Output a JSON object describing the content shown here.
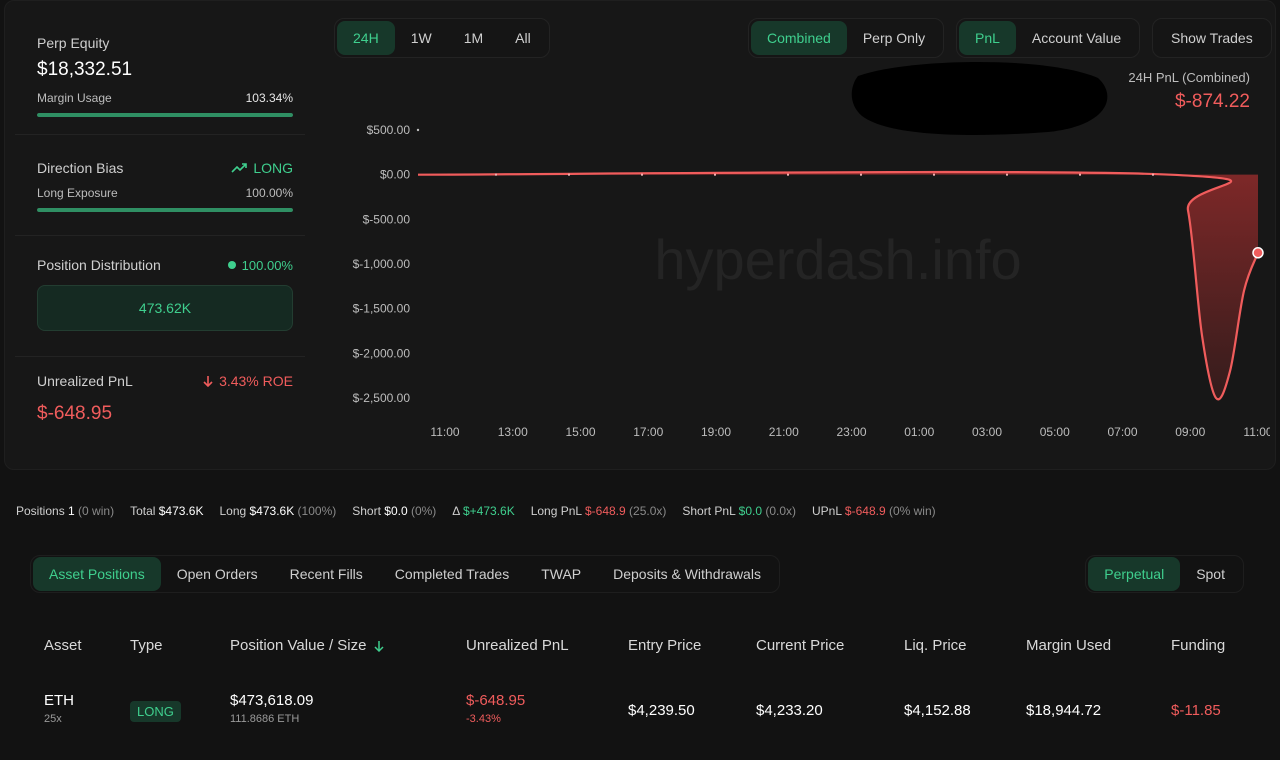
{
  "sidebar": {
    "perp_equity_label": "Perp Equity",
    "perp_equity_value": "$18,332.51",
    "margin_usage_label": "Margin Usage",
    "margin_usage_value": "103.34%",
    "margin_usage_fill": 1.0,
    "direction_bias_label": "Direction Bias",
    "direction_bias_value": "LONG",
    "long_exposure_label": "Long Exposure",
    "long_exposure_value": "100.00%",
    "long_exposure_fill": 1.0,
    "position_distribution_label": "Position Distribution",
    "position_distribution_value": "100.00%",
    "distribution_box_value": "473.62K",
    "unrealized_pnl_label": "Unrealized PnL",
    "unrealized_pnl_roe": "3.43% ROE",
    "unrealized_pnl_value": "$-648.95"
  },
  "timeframes": [
    {
      "label": "24H",
      "active": true
    },
    {
      "label": "1W",
      "active": false
    },
    {
      "label": "1M",
      "active": false
    },
    {
      "label": "All",
      "active": false
    }
  ],
  "modes": [
    {
      "label": "Combined",
      "active": true
    },
    {
      "label": "Perp Only",
      "active": false
    }
  ],
  "metrics": [
    {
      "label": "PnL",
      "active": true
    },
    {
      "label": "Account Value",
      "active": false
    }
  ],
  "show_trades_label": "Show Trades",
  "chart_header": {
    "title": "24H PnL (Combined)",
    "value": "$-874.22"
  },
  "chart_data": {
    "type": "area",
    "title": "24H PnL (Combined)",
    "watermark": "hyperdash.info",
    "x_ticks": [
      "11:00",
      "13:00",
      "15:00",
      "17:00",
      "19:00",
      "21:00",
      "23:00",
      "01:00",
      "03:00",
      "05:00",
      "07:00",
      "09:00",
      "11:00"
    ],
    "y_ticks": [
      "$500.00",
      "$0.00",
      "$-500.00",
      "$-1,000.00",
      "$-1,500.00",
      "$-2,000.00",
      "$-2,500.00"
    ],
    "y_tick_values": [
      500,
      0,
      -500,
      -1000,
      -1500,
      -2000,
      -2500
    ],
    "ylim": [
      -2500,
      500
    ],
    "xlim": [
      0,
      24
    ],
    "series": [
      {
        "x": [
          0,
          21.5,
          22.0,
          22.4,
          22.8,
          23.2,
          23.6,
          24.0
        ],
        "values": [
          0,
          0,
          -400,
          -1800,
          -2500,
          -2200,
          -1300,
          -874.22
        ]
      }
    ],
    "colors": {
      "line": "#f05c5c",
      "fill": "#8a2a2a"
    }
  },
  "stats": [
    {
      "label": "Positions",
      "value": "1",
      "extra": "(0 win)",
      "color": "#ffffff"
    },
    {
      "label": "Total",
      "value": "$473.6K",
      "extra": "",
      "color": "#ffffff"
    },
    {
      "label": "Long",
      "value": "$473.6K",
      "extra": "(100%)",
      "color": "#ffffff"
    },
    {
      "label": "Short",
      "value": "$0.0",
      "extra": "(0%)",
      "color": "#ffffff"
    },
    {
      "label": "Δ",
      "value": "$+473.6K",
      "extra": "",
      "color": "#3fcf8e"
    },
    {
      "label": "Long PnL",
      "value": "$-648.9",
      "extra": "(25.0x)",
      "color": "#f05c5c"
    },
    {
      "label": "Short PnL",
      "value": "$0.0",
      "extra": "(0.0x)",
      "color": "#3fcf8e"
    },
    {
      "label": "UPnL",
      "value": "$-648.9",
      "extra": "(0% win)",
      "color": "#f05c5c"
    }
  ],
  "tabs": [
    {
      "label": "Asset Positions",
      "active": true
    },
    {
      "label": "Open Orders",
      "active": false
    },
    {
      "label": "Recent Fills",
      "active": false
    },
    {
      "label": "Completed Trades",
      "active": false
    },
    {
      "label": "TWAP",
      "active": false
    },
    {
      "label": "Deposits & Withdrawals",
      "active": false
    }
  ],
  "market_tabs": [
    {
      "label": "Perpetual",
      "active": true
    },
    {
      "label": "Spot",
      "active": false
    }
  ],
  "table": {
    "headers": [
      "Asset",
      "Type",
      "Position Value / Size",
      "Unrealized PnL",
      "Entry Price",
      "Current Price",
      "Liq. Price",
      "Margin Used",
      "Funding"
    ],
    "row": {
      "asset": "ETH",
      "leverage": "25x",
      "type": "LONG",
      "position_value": "$473,618.09",
      "position_size": "111.8686 ETH",
      "upnl": "$-648.95",
      "upnl_pct": "-3.43%",
      "entry_price": "$4,239.50",
      "current_price": "$4,233.20",
      "liq_price": "$4,152.88",
      "margin_used": "$18,944.72",
      "funding": "$-11.85"
    }
  }
}
